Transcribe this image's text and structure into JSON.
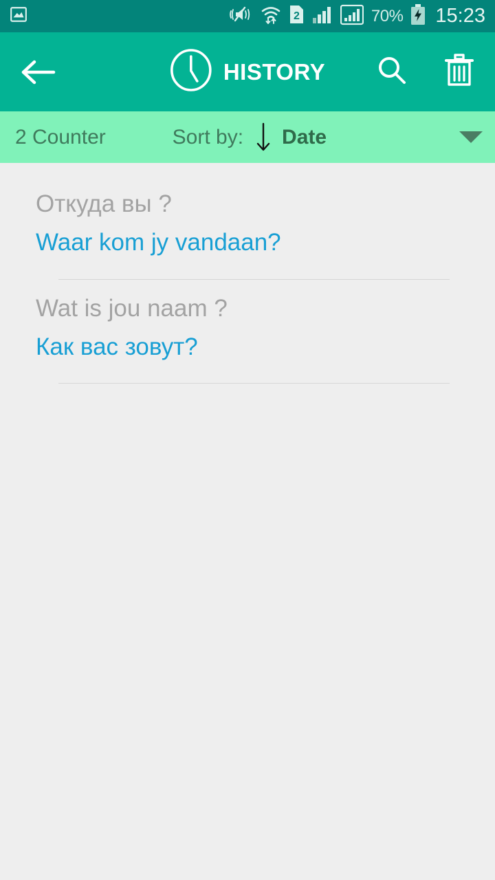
{
  "status_bar": {
    "icons": [
      {
        "name": "screenshot-gallery-icon",
        "glyph": "image"
      },
      {
        "name": "vibrate-mute-icon",
        "glyph": "speaker-muted"
      },
      {
        "name": "wifi-icon",
        "glyph": "wifi-transfer"
      },
      {
        "name": "sim-2-icon",
        "glyph": "sim-card",
        "label": "2"
      },
      {
        "name": "signal-sim1-icon",
        "glyph": "signal-bars"
      },
      {
        "name": "signal-sim2-icon",
        "glyph": "signal-bars-boxed"
      }
    ],
    "sim_label": "2",
    "battery_percent": "70%",
    "battery_charging": true,
    "time": "15:23",
    "background_color": "#03847a",
    "foreground_color": "#d9f0ec"
  },
  "app_bar": {
    "back_label": "Back",
    "clock_icon": "clock-icon",
    "title": "HISTORY",
    "search_label": "Search",
    "delete_label": "Delete all",
    "background_color": "#03b394",
    "title_color": "#ffffff"
  },
  "sort_bar": {
    "counter": "2 Counter",
    "sort_by_label": "Sort by:",
    "sort_direction": "descending",
    "sort_value": "Date",
    "dropdown_caret": "chevron-down-icon",
    "background_color": "#80f2b9",
    "text_color": "#3f7a5c",
    "value_color": "#2f6b4a"
  },
  "history": {
    "source_color": "#a3a3a3",
    "target_color": "#189fd4",
    "items": [
      {
        "source": "Откуда вы ?",
        "target": "Waar kom jy vandaan?"
      },
      {
        "source": "Wat is jou naam ?",
        "target": "Как вас зовут?"
      }
    ]
  }
}
